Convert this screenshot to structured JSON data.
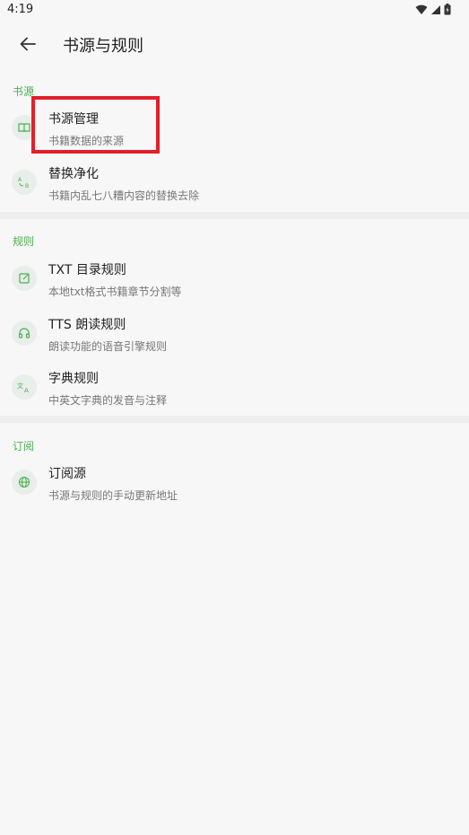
{
  "status": {
    "time": "4:19"
  },
  "app_bar": {
    "title": "书源与规则"
  },
  "sections": {
    "source": {
      "header": "书源"
    },
    "rules": {
      "header": "规则"
    },
    "subscribe": {
      "header": "订阅"
    }
  },
  "items": {
    "source_manage": {
      "title": "书源管理",
      "subtitle": "书籍数据的来源",
      "icon": "book-icon"
    },
    "replace_purify": {
      "title": "替换净化",
      "subtitle": "书籍内乱七八糟内容的替换去除",
      "icon": "replace-icon"
    },
    "txt_toc": {
      "title": "TXT 目录规则",
      "subtitle": "本地txt格式书籍章节分割等",
      "icon": "edit-icon"
    },
    "tts_read": {
      "title": "TTS 朗读规则",
      "subtitle": "朗读功能的语音引擎规则",
      "icon": "headphones-icon"
    },
    "dict": {
      "title": "字典规则",
      "subtitle": "中英文字典的发音与注释",
      "icon": "translate-icon"
    },
    "subscribe_source": {
      "title": "订阅源",
      "subtitle": "书源与规则的手动更新地址",
      "icon": "globe-icon"
    }
  },
  "colors": {
    "accent": "#4caf50",
    "highlight": "#e2202a",
    "background": "#f7f7f7"
  }
}
